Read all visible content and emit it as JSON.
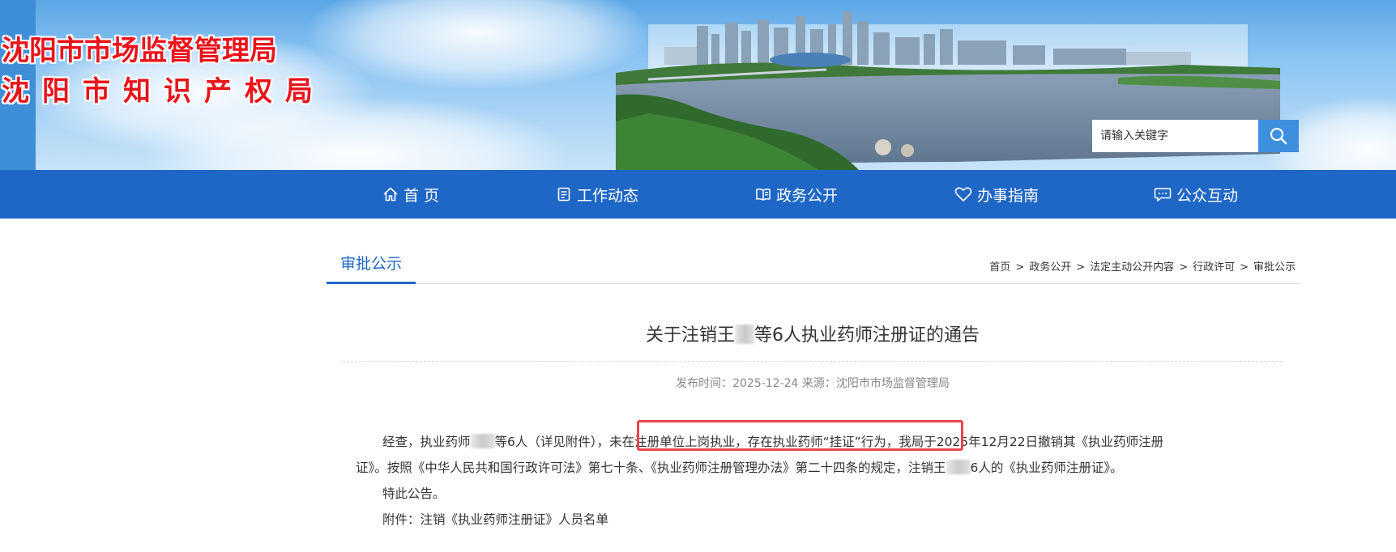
{
  "header": {
    "title_line1": "沈阳市市场监督管理局",
    "title_line2": "沈阳市知识产权局",
    "search_placeholder": "请输入关键字"
  },
  "nav": {
    "items": [
      {
        "label": "首 页",
        "icon": "home-icon"
      },
      {
        "label": "工作动态",
        "icon": "document-icon"
      },
      {
        "label": "政务公开",
        "icon": "book-icon"
      },
      {
        "label": "办事指南",
        "icon": "heart-icon"
      },
      {
        "label": "公众互动",
        "icon": "chat-icon"
      }
    ]
  },
  "section": {
    "tab_label": "审批公示",
    "breadcrumb": [
      "首页",
      "政务公开",
      "法定主动公开内容",
      "行政许可",
      "审批公示"
    ],
    "breadcrumb_separator": ">"
  },
  "article": {
    "title_prefix": "关于注销王",
    "title_suffix": "等6人执业药师注册证的通告",
    "meta": "发布时间：2025-12-24 来源：沈阳市市场监督管理局",
    "para1_a": "经查，执业药师",
    "para1_b": "等6人（详见附件）",
    "para1_c": "，未在注册单位上岗执业，存在执业药师“挂证”行为，",
    "para1_d": "我局于2025年12月22日撤销其《执业药师注册",
    "para2_a": "证》。按照《中华人民共和国行政许可法》第七十条、《执业药师注册管理办法》第二十四条的规定，注销王",
    "para2_b": "6人的《执业药师注册证》。",
    "para3": "特此公告。",
    "para4": "附件：注销《执业药师注册证》人员名单"
  },
  "colors": {
    "nav_bg": "#1f67c7",
    "title_red": "#e8141b",
    "highlight_border": "#e8474b",
    "search_button": "#3e8fe0"
  }
}
